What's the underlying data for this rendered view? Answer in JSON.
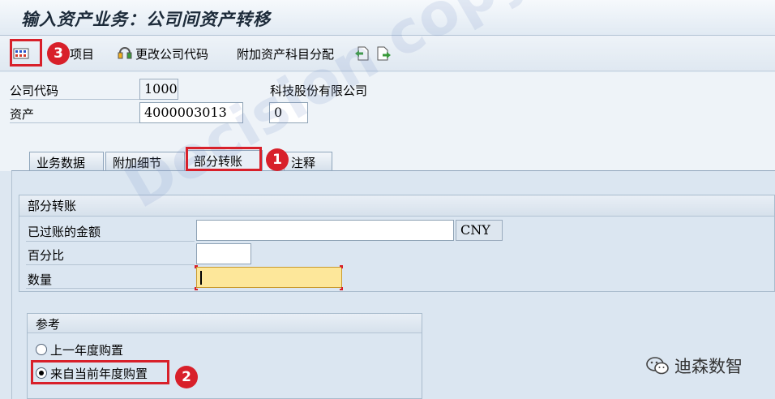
{
  "window": {
    "title": "输入资产业务：公司间资产转移"
  },
  "toolbar": {
    "items_label": "项目",
    "change_company_code_label": "更改公司代码",
    "additional_account_assignment_label": "附加资产科目分配"
  },
  "header": {
    "company_code_label": "公司代码",
    "company_code_value": "1000",
    "company_name": "科技股份有限公司",
    "asset_label": "资产",
    "asset_value": "4000003013",
    "sub_number_value": "0"
  },
  "tabs": [
    "业务数据",
    "附加细节",
    "部分转账",
    "注释"
  ],
  "partial_transfer": {
    "group_title": "部分转账",
    "posted_amount_label": "已过账的金额",
    "posted_amount_value": "",
    "currency": "CNY",
    "percentage_label": "百分比",
    "percentage_value": "",
    "quantity_label": "数量",
    "quantity_value": ""
  },
  "reference": {
    "group_title": "参考",
    "option_prior_year": "上一年度购置",
    "option_current_year": "来自当前年度购置",
    "selected": "来自当前年度购置"
  },
  "annotations": {
    "badge_1": "1",
    "badge_2": "2",
    "badge_3": "3"
  },
  "watermark": "Decision copyright",
  "brand": "迪森数智",
  "colors": {
    "accent_red": "#d8202a",
    "panel_bg": "#dbe6f1",
    "required_field": "#fde79a"
  }
}
